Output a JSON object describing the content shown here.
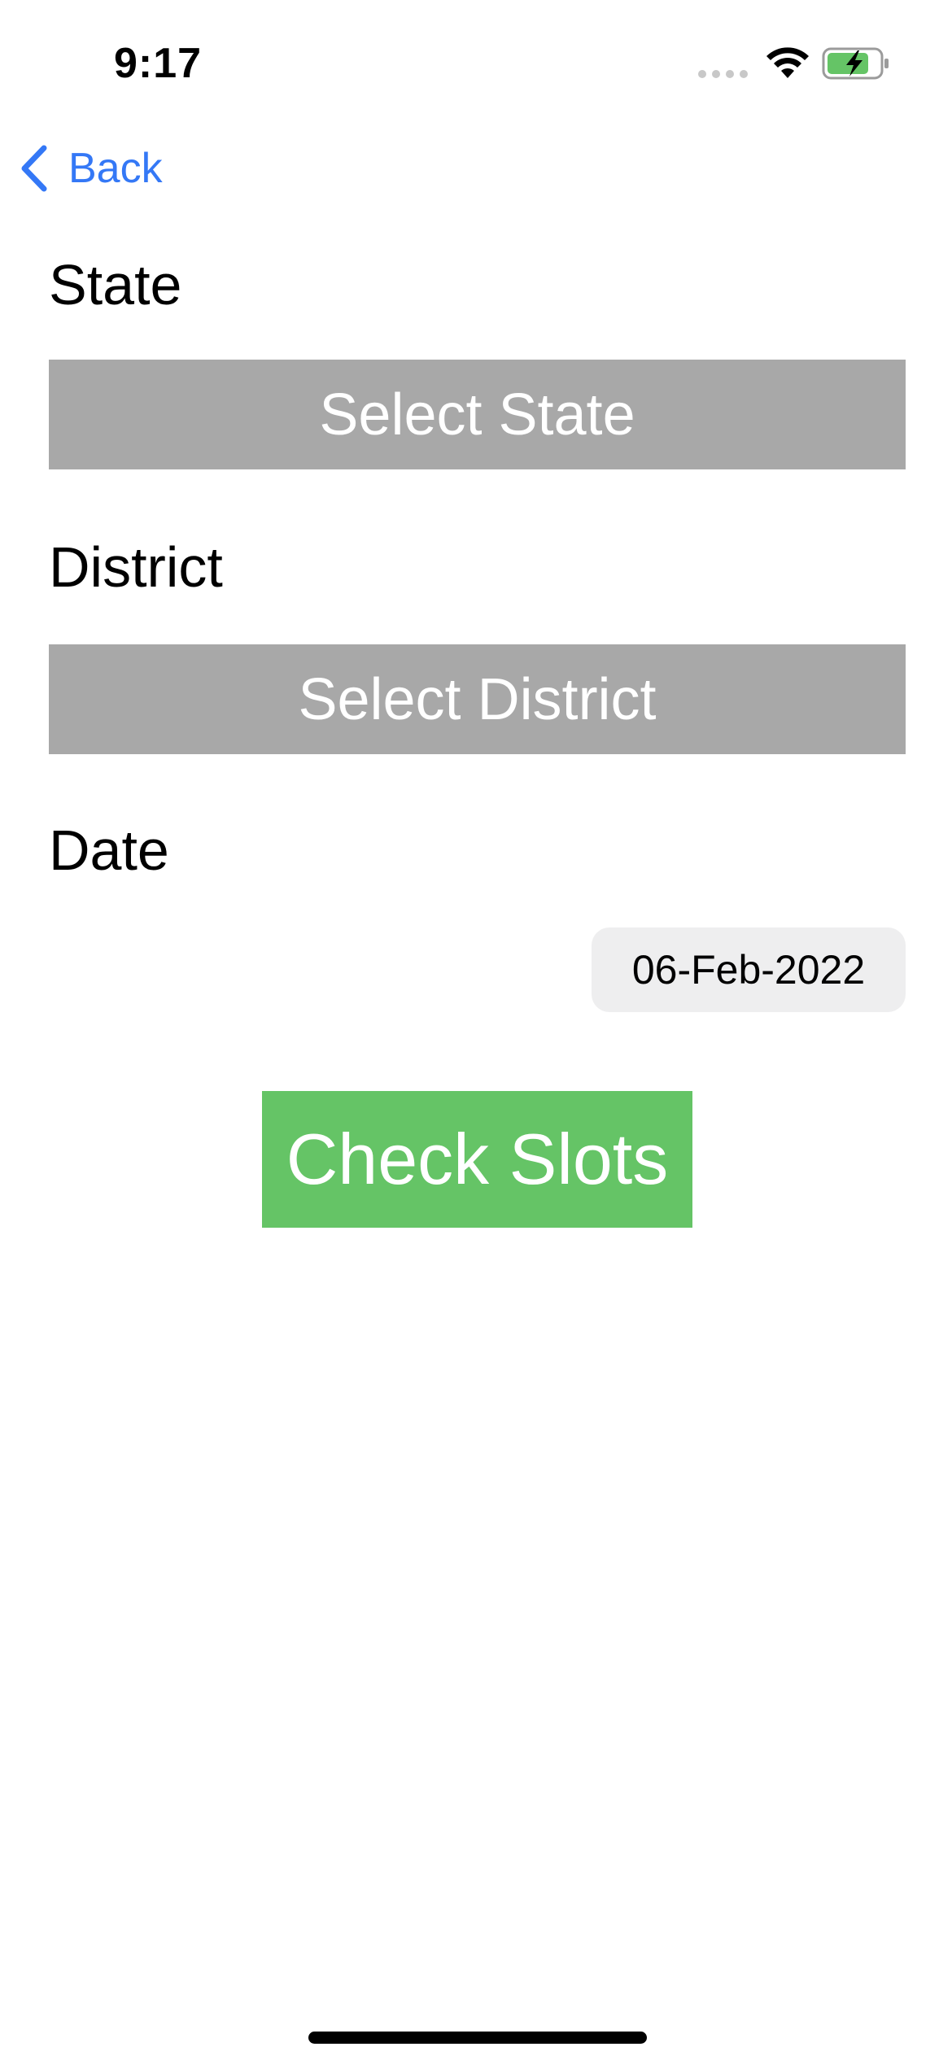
{
  "status_bar": {
    "time": "9:17",
    "icons": [
      "cellular-signal-icon",
      "wifi-icon",
      "battery-charging-icon"
    ]
  },
  "nav": {
    "back_label": "Back",
    "back_icon": "chevron-left-icon"
  },
  "form": {
    "state_label": "State",
    "state_button": "Select State",
    "district_label": "District",
    "district_button": "Select District",
    "date_label": "Date",
    "date_value": "06-Feb-2022",
    "submit_label": "Check Slots"
  },
  "colors": {
    "accent": "#3478f6",
    "select_button_bg": "#a8a8a8",
    "submit_button_bg": "#65c466",
    "date_pill_bg": "#eeeeef",
    "battery_fill": "#65c466"
  }
}
